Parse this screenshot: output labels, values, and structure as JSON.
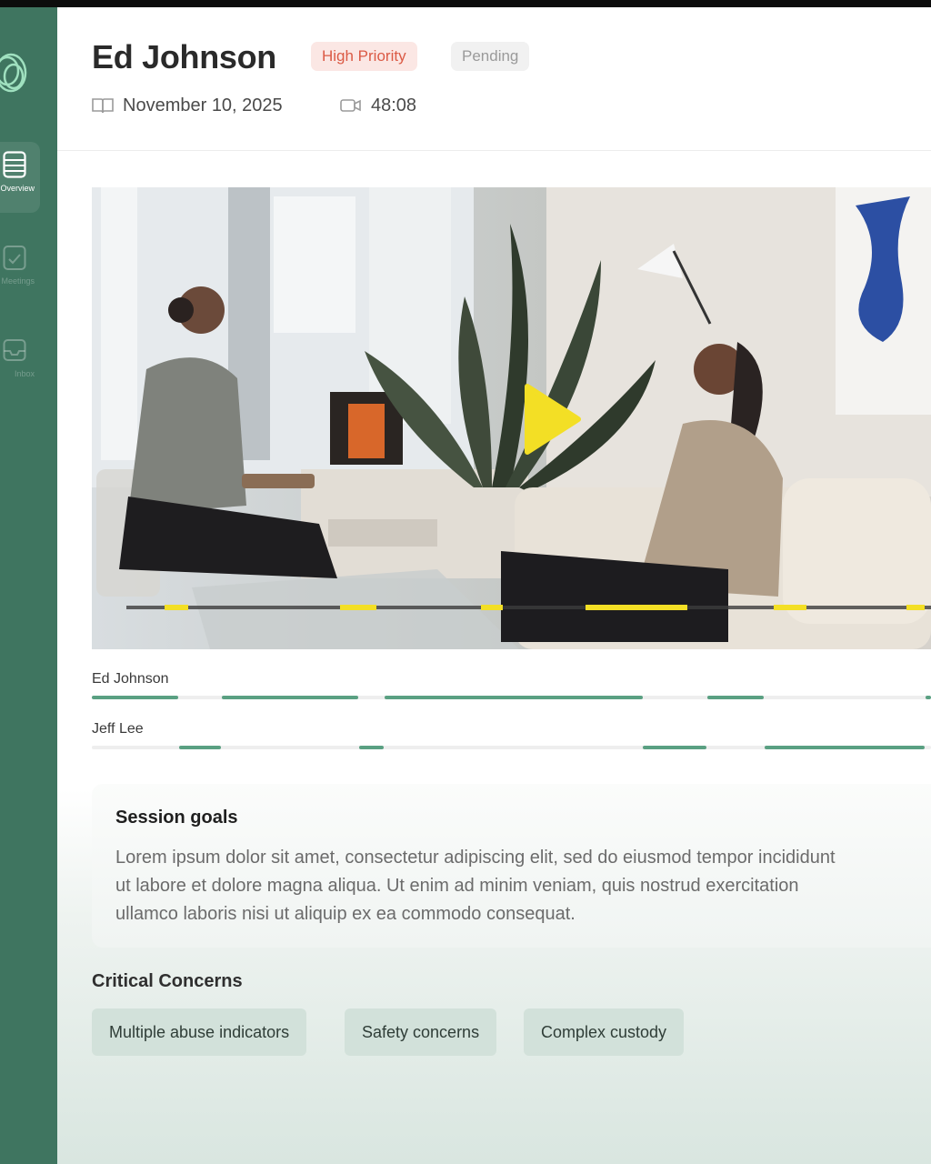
{
  "sidebar": {
    "items": [
      {
        "label": "Overview",
        "icon": "list-icon",
        "active": true
      },
      {
        "label": "Meetings",
        "icon": "calendar-check-icon",
        "active": false
      },
      {
        "label": "Inbox",
        "icon": "inbox-icon",
        "active": false
      }
    ]
  },
  "header": {
    "name": "Ed Johnson",
    "priority_badge": "High Priority",
    "status_badge": "Pending",
    "date": "November 10, 2025",
    "duration": "48:08"
  },
  "video": {
    "play_icon": "play-icon",
    "accent": "#f3df25"
  },
  "speakers": [
    {
      "name": "Ed Johnson"
    },
    {
      "name": "Jeff Lee"
    }
  ],
  "session_goals": {
    "title": "Session goals",
    "lines": [
      "Lorem ipsum dolor sit amet, consectetur adipiscing elit, sed do eiusmod tempor incididunt",
      "ut labore et dolore magna aliqua. Ut enim ad minim veniam, quis nostrud exercitation",
      "ullamco laboris nisi ut aliquip ex ea commodo consequat."
    ]
  },
  "critical_concerns": {
    "title": "Critical Concerns",
    "tags": [
      "Multiple abuse indicators",
      "Safety concerns",
      "Complex custody"
    ]
  },
  "colors": {
    "sidebar": "#3f7560",
    "track": "#5aa082",
    "priority": "#db5a45"
  }
}
